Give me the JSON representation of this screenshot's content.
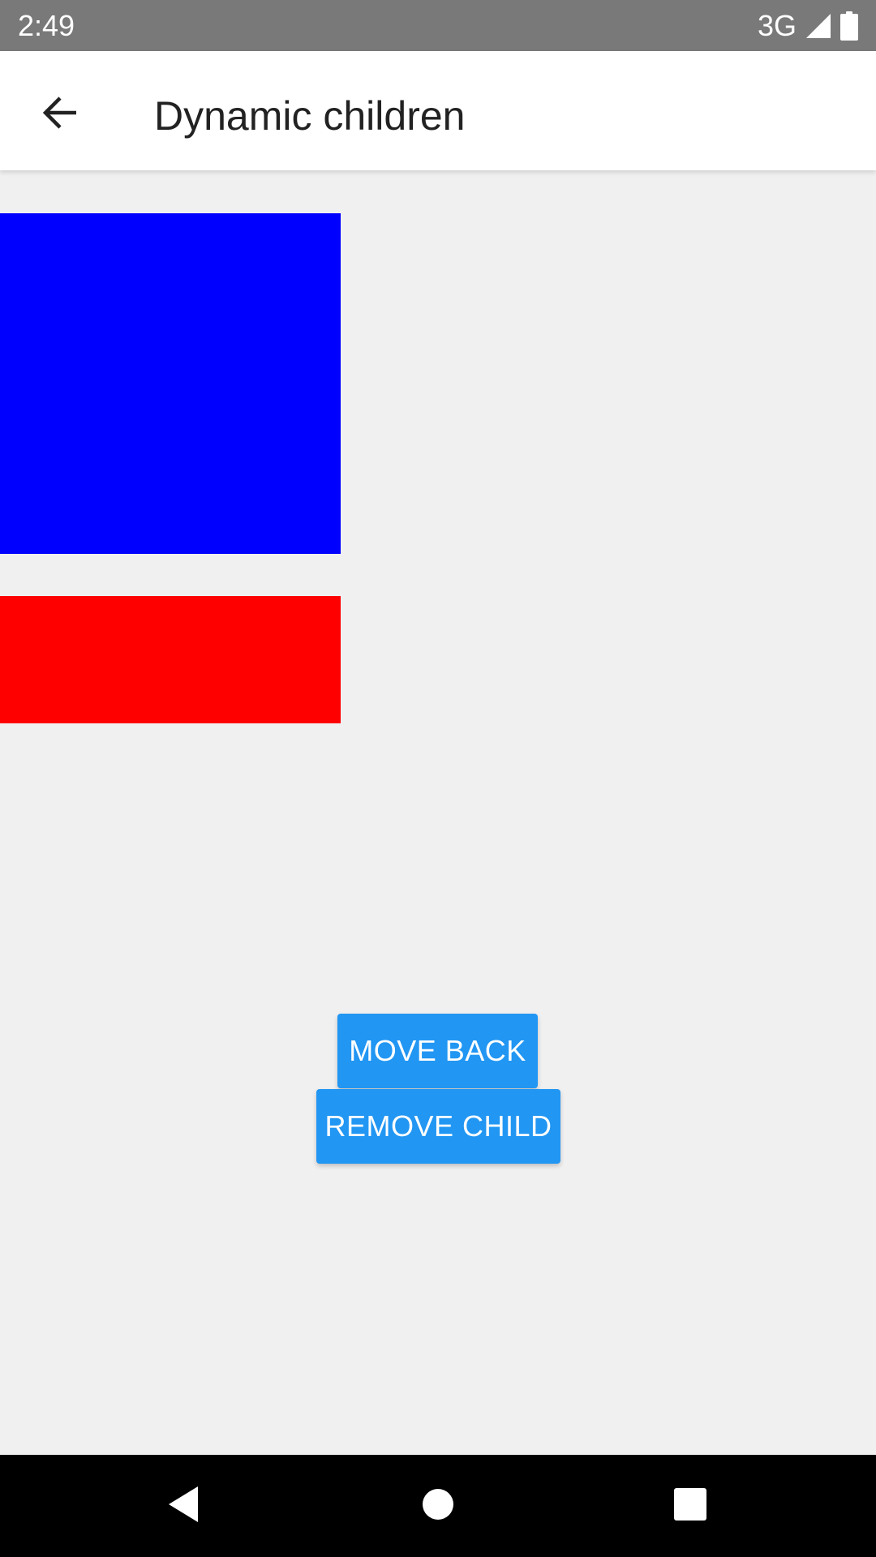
{
  "status_bar": {
    "time": "2:49",
    "network": "3G",
    "background": "#797979"
  },
  "app_bar": {
    "title": "Dynamic children",
    "back_icon": "arrow-back-icon"
  },
  "content": {
    "blue_box_color": "#0000ff",
    "red_box_color": "#ff0000",
    "buttons": {
      "move_back_label": "MOVE BACK",
      "remove_child_label": "REMOVE CHILD",
      "color": "#2196f3"
    }
  },
  "nav_bar": {
    "back_icon": "triangle-back-icon",
    "home_icon": "circle-home-icon",
    "recents_icon": "square-recents-icon"
  }
}
